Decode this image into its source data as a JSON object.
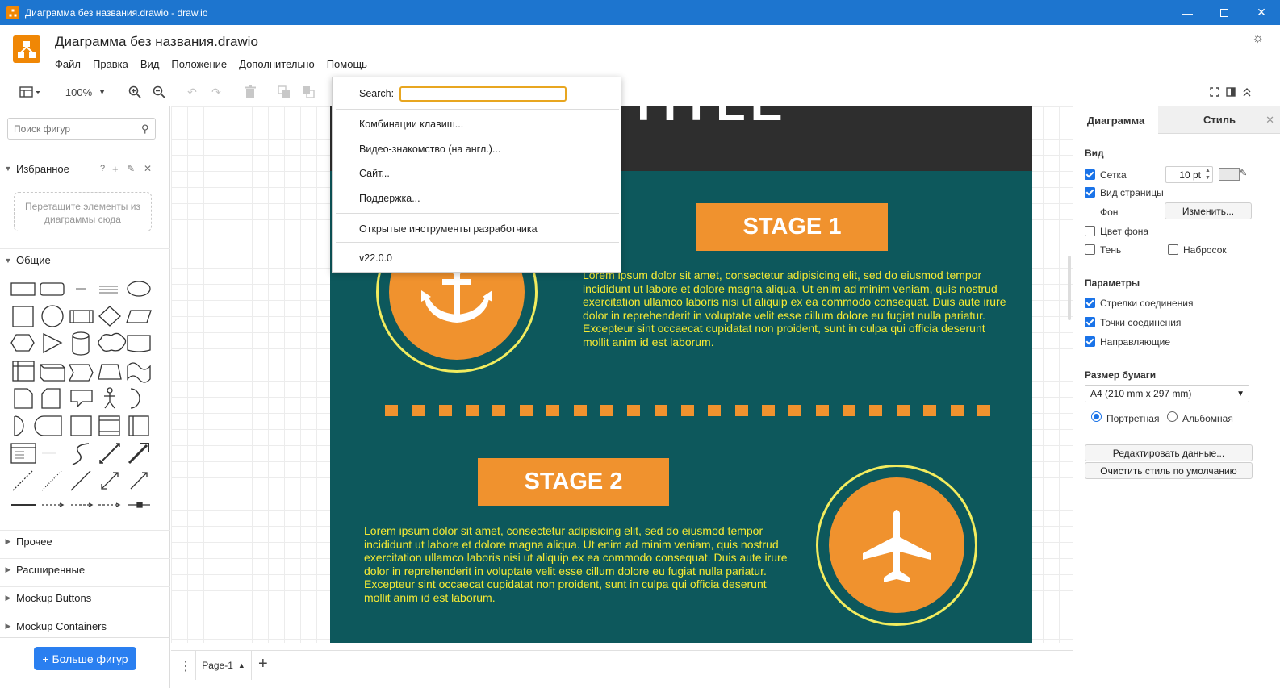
{
  "window": {
    "title": "Диаграмма без названия.drawio - draw.io"
  },
  "header": {
    "doc_title": "Диаграмма без названия.drawio",
    "menu": [
      "Файл",
      "Правка",
      "Вид",
      "Положение",
      "Дополнительно",
      "Помощь"
    ]
  },
  "toolbar": {
    "zoom": "100%"
  },
  "left": {
    "search_placeholder": "Поиск фигур",
    "favorites_label": "Избранное",
    "favorites_drop": "Перетащите элементы из диаграммы сюда",
    "general_label": "Общие",
    "sections": [
      "Прочее",
      "Расширенные",
      "Mockup Buttons",
      "Mockup Containers"
    ],
    "more_shapes": "+ Больше фигур"
  },
  "canvas": {
    "title_fragment": "TITLE",
    "stage1": "STAGE 1",
    "stage2": "STAGE 2",
    "lorem": "Lorem ipsum dolor sit amet, consectetur adipisicing elit, sed do eiusmod tempor incididunt ut labore et dolore magna aliqua. Ut enim ad minim veniam, quis nostrud exercitation ullamco laboris nisi ut aliquip ex ea commodo consequat. Duis aute irure dolor in reprehenderit in voluptate velit esse cillum dolore eu fugiat nulla pariatur. Excepteur sint occaecat cupidatat non proident, sunt in culpa qui officia deserunt mollit anim id est laborum.",
    "colors": {
      "background": "#0d585c",
      "accent": "#f0922e",
      "text": "#f5ea34"
    }
  },
  "help_menu": {
    "search_label": "Search:",
    "items": [
      "Комбинации клавиш...",
      "Видео-знакомство (на англ.)...",
      "Сайт...",
      "Поддержка..."
    ],
    "devtools": "Открытые инструменты разработчика",
    "version": "v22.0.0"
  },
  "right": {
    "tab_diagram": "Диаграмма",
    "tab_style": "Стиль",
    "view_label": "Вид",
    "grid": "Сетка",
    "grid_size": "10 pt",
    "page_view": "Вид страницы",
    "background": "Фон",
    "change_btn": "Изменить...",
    "bg_color": "Цвет фона",
    "shadow": "Тень",
    "sketch": "Набросок",
    "options_label": "Параметры",
    "connection_arrows": "Стрелки соединения",
    "connection_points": "Точки соединения",
    "guides": "Направляющие",
    "paper_size_label": "Размер бумаги",
    "paper_size": "A4 (210 mm x 297 mm)",
    "portrait": "Портретная",
    "landscape": "Альбомная",
    "edit_data": "Редактировать данные...",
    "clear_style": "Очистить стиль по умолчанию"
  },
  "bottom": {
    "page_tab": "Page-1"
  }
}
